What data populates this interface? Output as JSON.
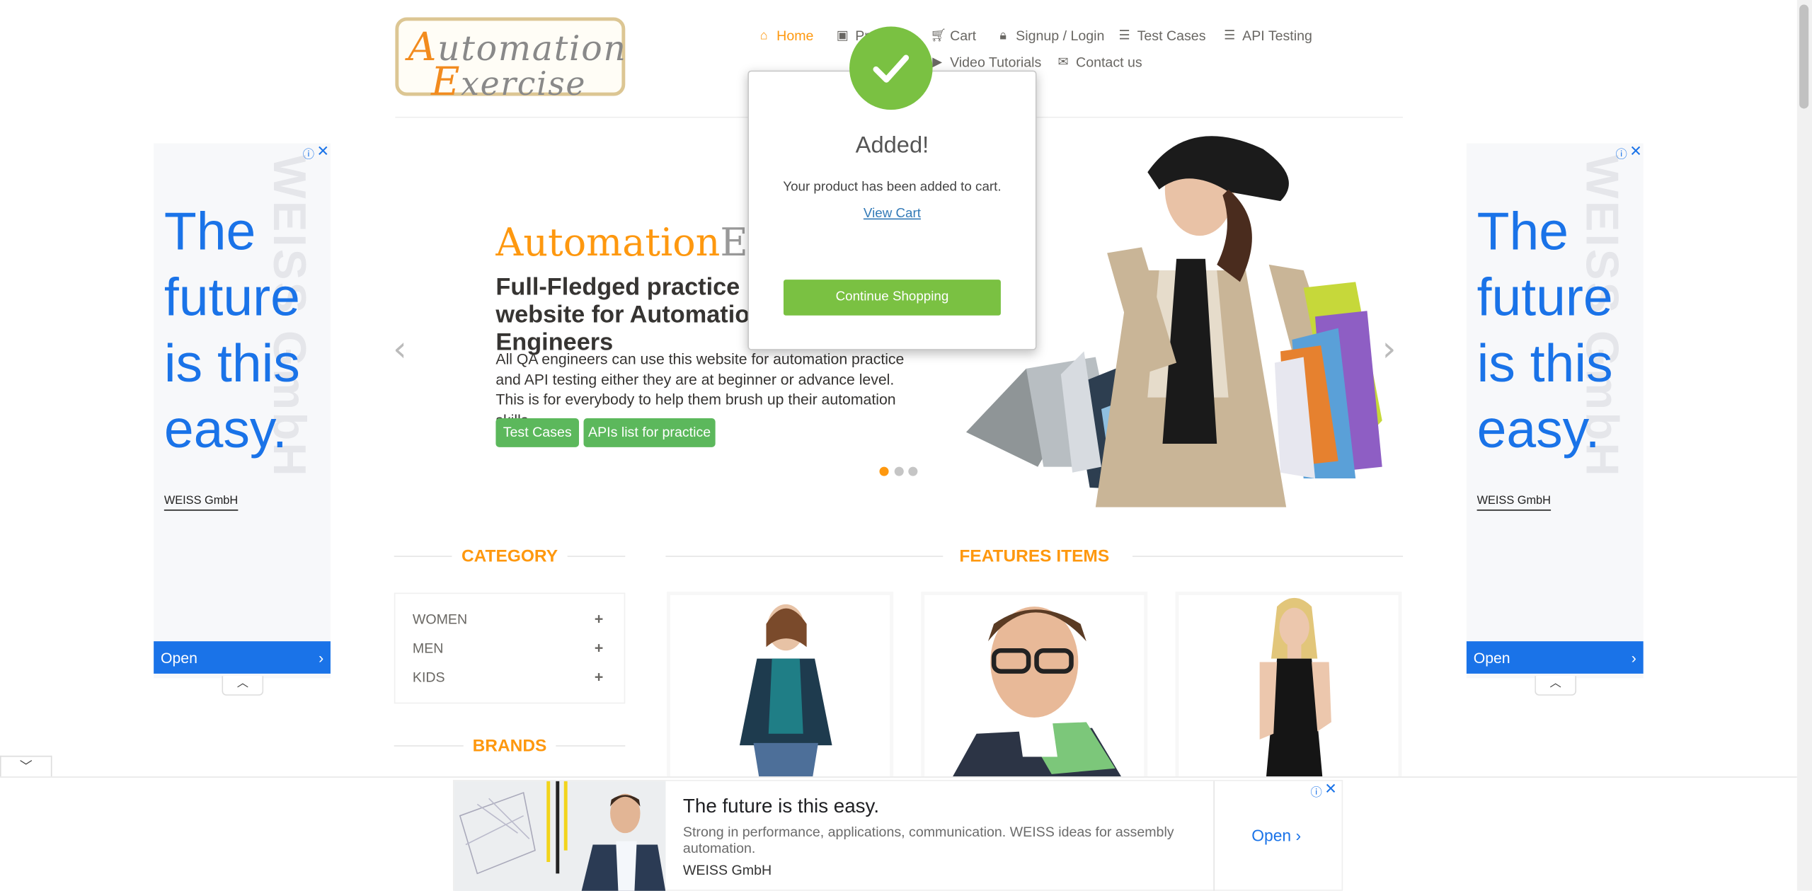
{
  "logo": {
    "line1": "Automation",
    "line2": "Exercise"
  },
  "nav": {
    "home": "Home",
    "products": "Products",
    "cart": "Cart",
    "signup": "Signup / Login",
    "test_cases": "Test Cases",
    "api_testing": "API Testing",
    "video_tutorials": "Video Tutorials",
    "contact": "Contact us"
  },
  "hero": {
    "title_part1": "Automation",
    "title_part2": "Exercise",
    "subtitle": "Full-Fledged practice website for Automation Engineers",
    "description": "All QA engineers can use this website for automation practice and API testing either they are at beginner or advance level. This is for everybody to help them brush up their automation skills.",
    "btn_test_cases": "Test Cases",
    "btn_apis": "APIs list for practice"
  },
  "side_ad": {
    "headline": "The future is this easy.",
    "watermark": "WEISS GmbH",
    "brand": "WEISS GmbH",
    "open": "Open"
  },
  "sidebar": {
    "category_title": "CATEGORY",
    "categories": [
      "WOMEN",
      "MEN",
      "KIDS"
    ],
    "brands_title": "BRANDS"
  },
  "features_title": "FEATURES ITEMS",
  "bottom_ad": {
    "title": "The future is this easy.",
    "description": "Strong in performance, applications, communication. WEISS ideas for assembly automation.",
    "brand": "WEISS GmbH",
    "open": "Open"
  },
  "modal": {
    "title": "Added!",
    "message": "Your product has been added to cart.",
    "view_cart": "View Cart",
    "continue": "Continue Shopping"
  },
  "colors": {
    "accent": "#fe980f",
    "green_button": "#5cb85c",
    "modal_green": "#7ac142",
    "ad_blue": "#1a73e8"
  }
}
